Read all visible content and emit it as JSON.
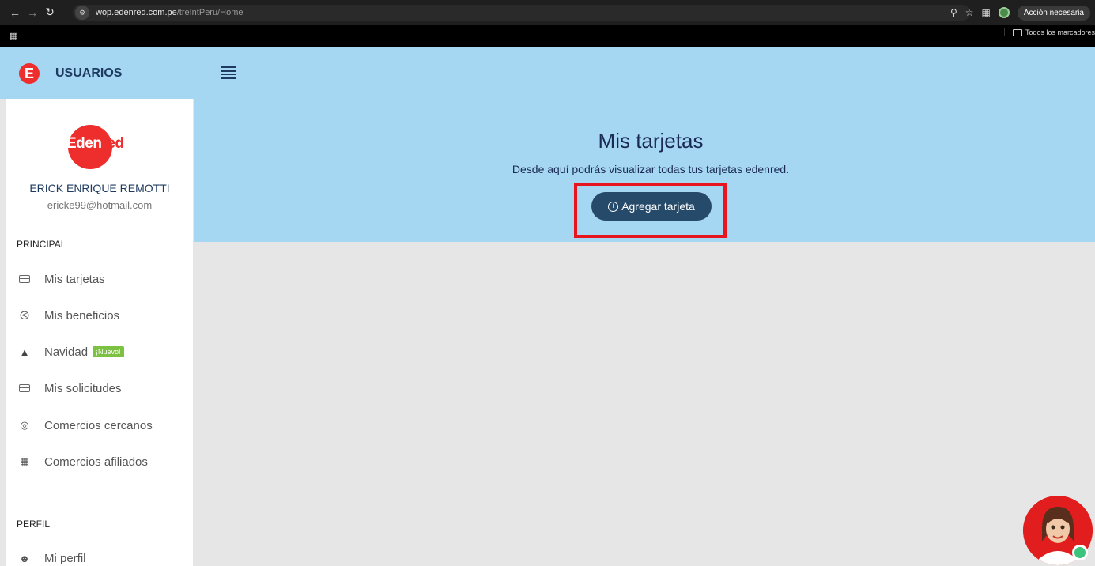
{
  "browser": {
    "url_host": "wop.edenred.com.pe",
    "url_path": "/treIntPeru/Home",
    "action_label": "Acción necesaria",
    "bookmarks_label": "Todos los marcadores",
    "back_icon": "arrow-left-icon",
    "forward_icon": "arrow-right-icon",
    "reload_icon": "reload-icon"
  },
  "header": {
    "title": "USUARIOS",
    "logo_letter": "E",
    "menu_icon": "hamburger-icon",
    "color_bg": "#a6d7f2"
  },
  "sidebar": {
    "logo_text_a": "Eden",
    "logo_text_b": "red",
    "user_name": "ERICK ENRIQUE REMOTTI",
    "user_email": "ericke99@hotmail.com",
    "section_principal": "PRINCIPAL",
    "section_perfil": "PERFIL",
    "items": [
      {
        "label": "Mis tarjetas",
        "icon": "card-icon"
      },
      {
        "label": "Mis beneficios",
        "icon": "tag-icon"
      },
      {
        "label": "Navidad",
        "icon": "tree-icon",
        "badge": "¡Nuevo!"
      },
      {
        "label": "Mis solicitudes",
        "icon": "card-icon"
      },
      {
        "label": "Comercios cercanos",
        "icon": "location-icon"
      },
      {
        "label": "Comercios afiliados",
        "icon": "map-icon"
      }
    ],
    "profile_items": [
      {
        "label": "Mi perfil",
        "icon": "user-icon"
      }
    ]
  },
  "main": {
    "title": "Mis tarjetas",
    "subtitle": "Desde aquí podrás visualizar todas tus tarjetas edenred.",
    "add_button_label": "Agregar tarjeta",
    "accent_color": "#264a6a",
    "highlight_color": "#e8141e"
  }
}
